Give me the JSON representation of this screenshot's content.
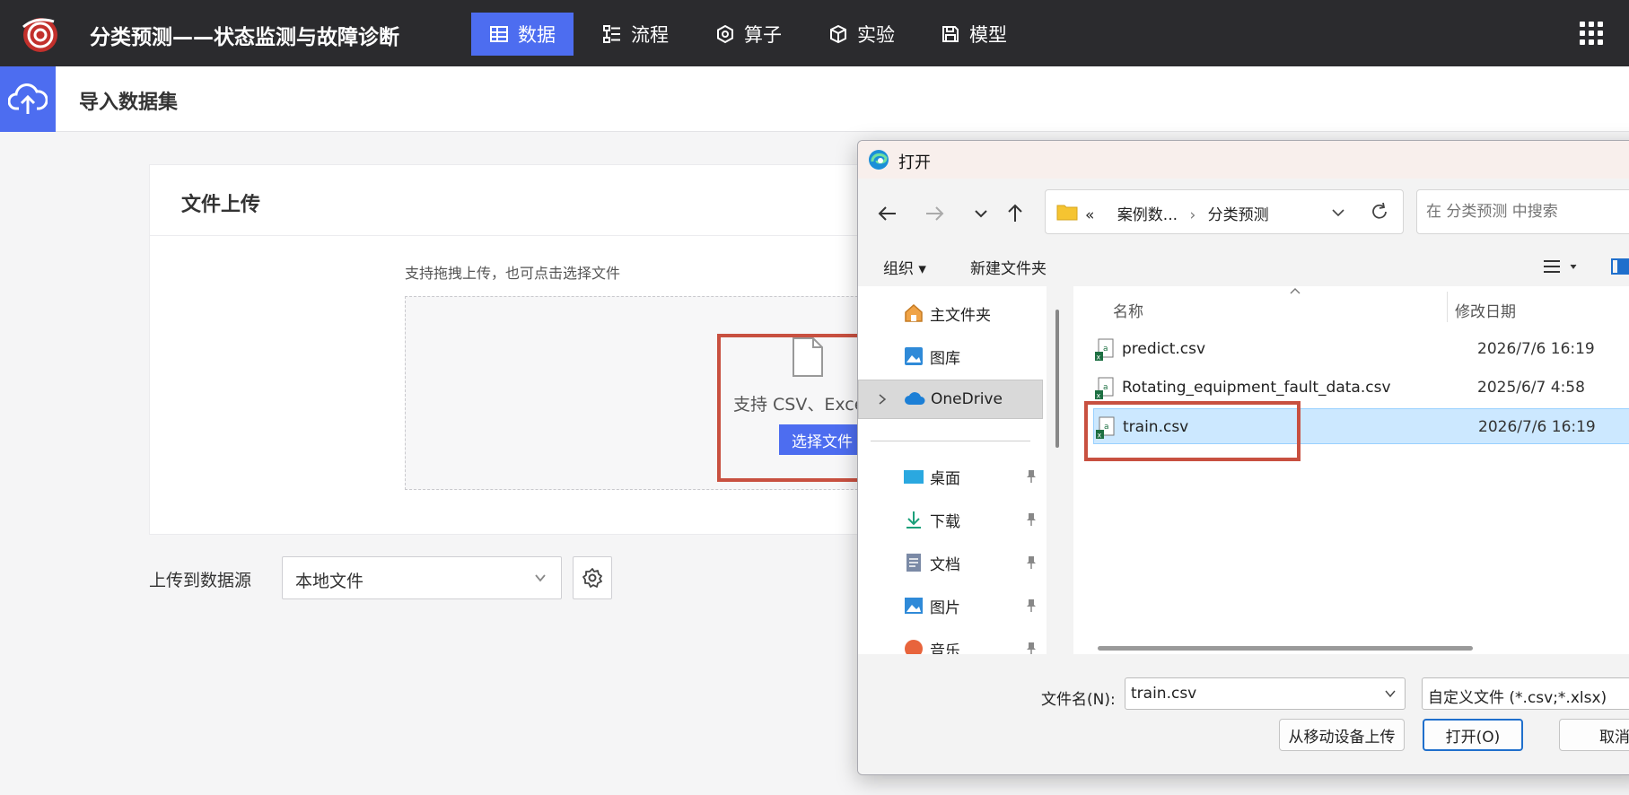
{
  "app": {
    "title": "分类预测——状态监测与故障诊断"
  },
  "nav": {
    "items": [
      {
        "label": "数据",
        "icon": "table-icon",
        "active": true
      },
      {
        "label": "流程",
        "icon": "flow-icon",
        "active": false
      },
      {
        "label": "算子",
        "icon": "hexagon-icon",
        "active": false
      },
      {
        "label": "实验",
        "icon": "cube-icon",
        "active": false
      },
      {
        "label": "模型",
        "icon": "save-icon",
        "active": false
      }
    ]
  },
  "page": {
    "title": "导入数据集"
  },
  "upload_card": {
    "title": "文件上传",
    "hint": "支持拖拽上传，也可点击选择文件",
    "support_text": "支持 CSV、Excel",
    "choose_button": "选择文件"
  },
  "datasource": {
    "label": "上传到数据源",
    "value": "本地文件"
  },
  "dialog": {
    "title": "打开",
    "path": {
      "prefix": "«",
      "parent": "案例数...",
      "current": "分类预测"
    },
    "search_placeholder": "在 分类预测 中搜索",
    "toolbar": {
      "organize": "组织 ▾",
      "new_folder": "新建文件夹"
    },
    "nav_pane": {
      "items": [
        {
          "label": "主文件夹",
          "icon": "home-icon"
        },
        {
          "label": "图库",
          "icon": "gallery-icon"
        },
        {
          "label": "OneDrive",
          "icon": "cloud-icon",
          "selected": true
        },
        {
          "label": "桌面",
          "icon": "desktop-icon",
          "pinned": true
        },
        {
          "label": "下载",
          "icon": "download-icon",
          "pinned": true
        },
        {
          "label": "文档",
          "icon": "document-icon",
          "pinned": true
        },
        {
          "label": "图片",
          "icon": "picture-icon",
          "pinned": true
        },
        {
          "label": "音乐",
          "icon": "music-icon",
          "pinned": true
        }
      ]
    },
    "columns": {
      "name": "名称",
      "modified": "修改日期"
    },
    "files": [
      {
        "name": "predict.csv",
        "modified": "2026/7/6 16:19",
        "selected": false
      },
      {
        "name": "Rotating_equipment_fault_data.csv",
        "modified": "2025/6/7 4:58",
        "selected": false
      },
      {
        "name": "train.csv",
        "modified": "2026/7/6 16:19",
        "selected": true
      }
    ],
    "filename_label": "文件名(N):",
    "filename_value": "train.csv",
    "filetype": "自定义文件 (*.csv;*.xlsx)",
    "buttons": {
      "mobile": "从移动设备上传",
      "open": "打开(O)",
      "cancel": "取消"
    }
  },
  "colors": {
    "accent": "#4d6df0",
    "topbar": "#2b2b2e",
    "highlight": "#c85040",
    "selection": "#cce8ff"
  }
}
